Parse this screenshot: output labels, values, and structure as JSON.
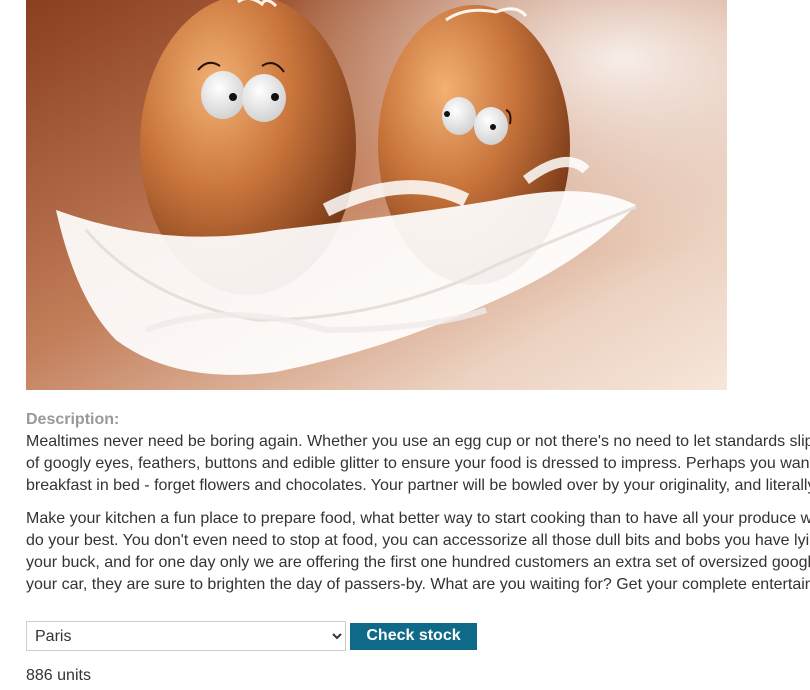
{
  "product": {
    "image_alt": "Two brown eggs with googly eyes resting on a white feather"
  },
  "description": {
    "heading": "Description:",
    "paragraphs": [
      [
        "Mealtimes never need be boring again. Whether you use an egg cup or not there's no need to let standards slip",
        "of googly eyes, feathers, buttons and edible glitter to ensure your food is dressed to impress. Perhaps you want",
        "breakfast in bed - forget flowers and chocolates. Your partner will be bowled over by your originality, and literally"
      ],
      [
        "Make your kitchen a fun place to prepare food, what better way to start cooking than to have all your produce w",
        "do your best. You don't even need to stop at food, you can accessorize all those dull bits and bobs you have lyi",
        "your buck, and for one day only we are offering the first one hundred customers an extra set of oversized googl",
        "your car, they are sure to brighten the day of passers-by. What are you waiting for? Get your complete entertain"
      ]
    ]
  },
  "stock_check": {
    "store_options": [
      "Paris"
    ],
    "selected_store": "Paris",
    "button_label": "Check stock",
    "result": "886 units"
  },
  "colors": {
    "button_background": "#0f6a8a",
    "heading": "#999999",
    "text": "#333333"
  }
}
